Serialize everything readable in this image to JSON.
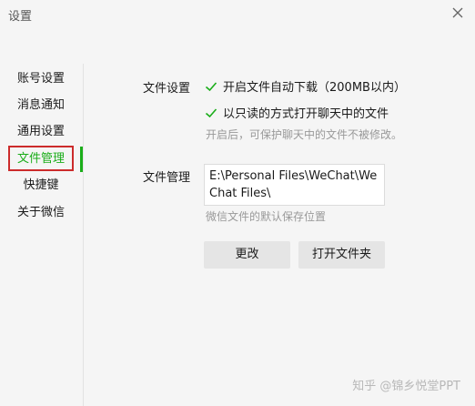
{
  "window": {
    "title": "设置"
  },
  "sidebar": {
    "items": [
      {
        "label": "账号设置"
      },
      {
        "label": "消息通知"
      },
      {
        "label": "通用设置"
      },
      {
        "label": "文件管理",
        "active": true
      },
      {
        "label": "快捷键"
      },
      {
        "label": "关于微信"
      }
    ]
  },
  "file_settings": {
    "section_label": "文件设置",
    "auto_download_label": "开启文件自动下载（200MB以内）",
    "auto_download_checked": true,
    "readonly_label": "以只读的方式打开聊天中的文件",
    "readonly_checked": true,
    "readonly_hint": "开启后，可保护聊天中的文件不被修改。"
  },
  "file_management": {
    "section_label": "文件管理",
    "path_value": "E:\\Personal Files\\WeChat\\WeChat Files\\",
    "path_hint": "微信文件的默认保存位置",
    "change_button": "更改",
    "open_folder_button": "打开文件夹"
  },
  "watermark": "知乎 @锦乡悦堂PPT",
  "colors": {
    "accent": "#1aad19",
    "highlight": "#cc2b2b",
    "background": "#f5f5f5"
  }
}
